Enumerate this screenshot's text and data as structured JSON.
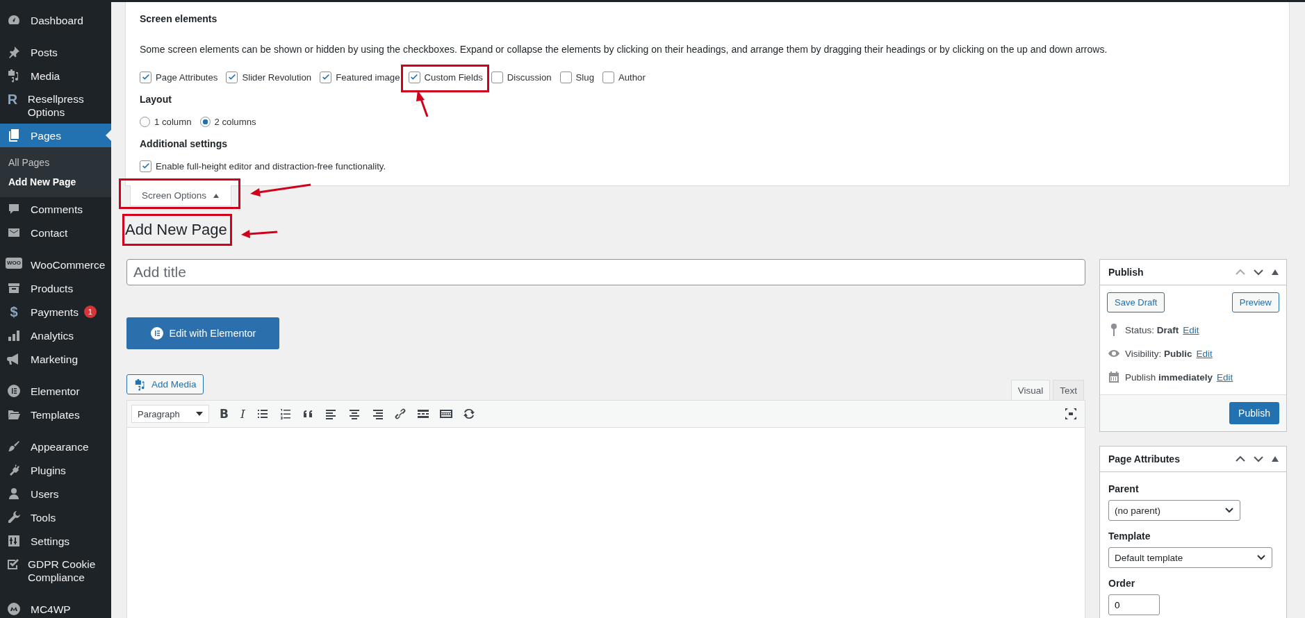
{
  "sidebar": {
    "groups": [
      {
        "items": [
          {
            "label": "Dashboard",
            "selected": false
          }
        ]
      },
      {
        "items": [
          {
            "label": "Posts",
            "selected": false
          },
          {
            "label": "Media",
            "selected": false
          },
          {
            "label": "Resellpress Options",
            "icon_text": "R",
            "selected": false
          },
          {
            "label": "Pages",
            "selected": true,
            "children": [
              {
                "label": "All Pages",
                "selected": false
              },
              {
                "label": "Add New Page",
                "selected": true
              }
            ]
          },
          {
            "label": "Comments",
            "selected": false
          },
          {
            "label": "Contact",
            "selected": false
          }
        ]
      },
      {
        "items": [
          {
            "label": "WooCommerce",
            "icon_text": "WOO",
            "selected": false
          },
          {
            "label": "Products",
            "selected": false
          },
          {
            "label": "Payments",
            "icon_text": "$",
            "badge": "1",
            "selected": false
          },
          {
            "label": "Analytics",
            "selected": false
          },
          {
            "label": "Marketing",
            "selected": false
          }
        ]
      },
      {
        "items": [
          {
            "label": "Elementor",
            "selected": false
          },
          {
            "label": "Templates",
            "selected": false
          }
        ]
      },
      {
        "items": [
          {
            "label": "Appearance",
            "selected": false
          },
          {
            "label": "Plugins",
            "selected": false
          },
          {
            "label": "Users",
            "selected": false
          },
          {
            "label": "Tools",
            "selected": false
          },
          {
            "label": "Settings",
            "selected": false
          },
          {
            "label": "GDPR Cookie Compliance",
            "selected": false
          }
        ]
      },
      {
        "items": [
          {
            "label": "MC4WP",
            "selected": false
          }
        ]
      }
    ]
  },
  "screen_options": {
    "heading": "Screen elements",
    "description": "Some screen elements can be shown or hidden by using the checkboxes. Expand or collapse the elements by clicking on their headings, and arrange them by dragging their headings or by clicking on the up and down arrows.",
    "boxes": [
      {
        "label": "Page Attributes",
        "checked": true
      },
      {
        "label": "Slider Revolution",
        "checked": true
      },
      {
        "label": "Featured image",
        "checked": true
      },
      {
        "label": "Custom Fields",
        "checked": true
      },
      {
        "label": "Discussion",
        "checked": false
      },
      {
        "label": "Slug",
        "checked": false
      },
      {
        "label": "Author",
        "checked": false
      }
    ],
    "layout_heading": "Layout",
    "columns": [
      {
        "label": "1 column",
        "selected": false
      },
      {
        "label": "2 columns",
        "selected": true
      }
    ],
    "additional_heading": "Additional settings",
    "additional": [
      {
        "label": "Enable full-height editor and distraction-free functionality.",
        "checked": true
      }
    ],
    "toggle": "Screen Options"
  },
  "heading": "Add New Page",
  "title_placeholder": "Add title",
  "elementor_button": "Edit with Elementor",
  "add_media": "Add Media",
  "editor": {
    "format": "Paragraph",
    "bold": "B",
    "italic": "I",
    "tabs": [
      {
        "label": "Visual",
        "selected": true
      },
      {
        "label": "Text",
        "selected": false
      }
    ]
  },
  "publish": {
    "title": "Publish",
    "save_draft": "Save Draft",
    "preview": "Preview",
    "rows": [
      {
        "text": "Status: **Draft**",
        "link": "Edit"
      },
      {
        "text": "Visibility: **Public**",
        "link": "Edit"
      },
      {
        "text": "Publish **immediately**",
        "link": "Edit"
      }
    ],
    "button": "Publish"
  },
  "page_attributes": {
    "title": "Page Attributes",
    "parent_label": "Parent",
    "parent": "(no parent)",
    "template_label": "Template",
    "template": "Default template",
    "order_label": "Order",
    "order": "0"
  }
}
